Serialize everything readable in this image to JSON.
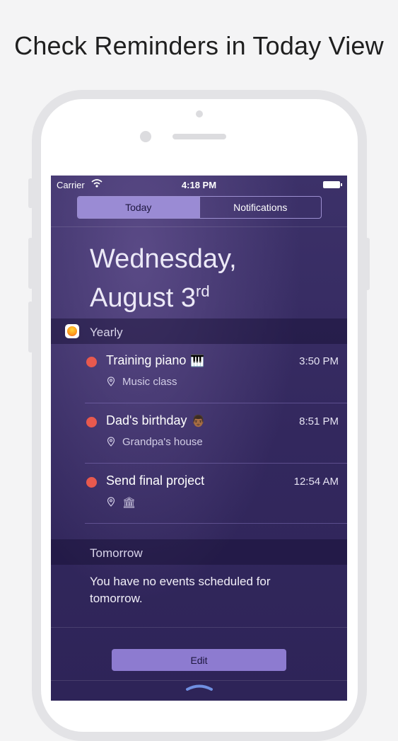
{
  "headline": "Check Reminders in Today View",
  "status_bar": {
    "carrier": "Carrier",
    "time": "4:18 PM"
  },
  "segmented": {
    "today": "Today",
    "notifications": "Notifications"
  },
  "date": {
    "line1": "Wednesday,",
    "line2": "August 3",
    "suffix": "rd"
  },
  "yearly": {
    "title": "Yearly",
    "reminders": [
      {
        "title": "Training piano",
        "emoji": "🎹",
        "time": "3:50 PM",
        "location": "Music class"
      },
      {
        "title": "Dad's birthday",
        "emoji": "👨🏾",
        "time": "8:51 PM",
        "location": "Grandpa's house"
      },
      {
        "title": "Send final project",
        "emoji": "",
        "time": "12:54 AM",
        "location": "🏛"
      }
    ]
  },
  "tomorrow": {
    "title": "Tomorrow",
    "message": "You have no events scheduled for tomorrow."
  },
  "edit_label": "Edit",
  "colors": {
    "accent": "#9a8bd4",
    "reminder_dot": "#e8594e",
    "background": "#33285e"
  }
}
